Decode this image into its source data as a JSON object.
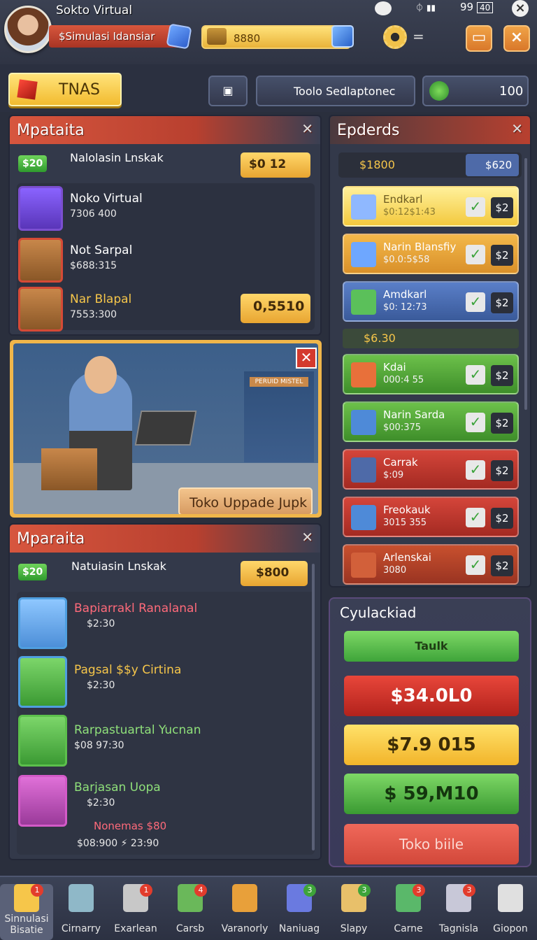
{
  "status": {
    "signal": "99",
    "battery_label": "40"
  },
  "header": {
    "game_title": "Sokto Virtual",
    "player_name": "$Simulasi Idansiar",
    "gold": "8880",
    "top_eq": "="
  },
  "toolbar": {
    "tnas_label": "TNAS",
    "center_label": "Toolo Sedlaptonec",
    "currency": "100"
  },
  "left_panel": {
    "title": "Mpataita",
    "badge": "$20",
    "subtitle": "Nalolasin Lnskak",
    "price": "$0 12",
    "items": [
      {
        "title": "Noko Virtual",
        "sub": "7306 400"
      },
      {
        "title": "Not Sarpal",
        "sub": "$688:315"
      },
      {
        "title": "Nar Blapal",
        "sub": "7553:300",
        "price": "0,5510"
      }
    ]
  },
  "promo": {
    "store_sign": "PERUID MISTEL",
    "button": "Toko Uppade Jupk"
  },
  "lower_panel": {
    "title": "Mparaita",
    "badge": "$20",
    "subtitle": "Natuiasin Lnskak",
    "price": "$800",
    "items": [
      {
        "title": "Bapiarrakl Ranalanal",
        "sub": "$2:30"
      },
      {
        "title": "Pagsal $$y Cirtina",
        "sub": "$2:30"
      },
      {
        "title": "Rarpastuartal Yucnan",
        "sub": "$08 97:30"
      },
      {
        "title": "Barjasan Uopa",
        "sub": "$2:30",
        "extra": "Nonemas $80",
        "extra2": "$08:900 ⚡ 23:90"
      }
    ]
  },
  "right_panel": {
    "title": "Epderds",
    "top_left": "$1800",
    "top_right": "$620",
    "section": "$6.30",
    "items": [
      {
        "title": "Endkarl",
        "sub": "$0:12$1:43",
        "num": "$2"
      },
      {
        "title": "Narin Blansfiy",
        "sub": "$0.0:5$58",
        "num": "$2"
      },
      {
        "title": "Amdkarl",
        "sub": "$0: 12:73",
        "num": "$2"
      },
      {
        "title": "Kdai",
        "sub": "000:4 55",
        "num": "$2"
      },
      {
        "title": "Narin Sarda",
        "sub": "$00:375",
        "num": "$2"
      },
      {
        "title": "Carrak",
        "sub": "$:09",
        "num": "$2"
      },
      {
        "title": "Freokauk",
        "sub": "3015 355",
        "num": "$2"
      },
      {
        "title": "Arlenskai",
        "sub": "3080",
        "num": "$2"
      }
    ]
  },
  "calc": {
    "title": "Cyulackiad",
    "tab": "Taulk",
    "b1": "$34.0L0",
    "b2": "$7.9 015",
    "b3": "$ 59,M10",
    "b4": "Toko biile"
  },
  "nav": [
    {
      "label": "Sinnulasi Bisatie",
      "badge": "1"
    },
    {
      "label": "Cirnarry",
      "badge": ""
    },
    {
      "label": "Exarlean",
      "badge": "1"
    },
    {
      "label": "Carsb",
      "badge": "4"
    },
    {
      "label": "Varanorly",
      "badge": ""
    },
    {
      "label": "Naniuag",
      "badge": "3"
    },
    {
      "label": "Slapy",
      "badge": "3"
    },
    {
      "label": "Carne",
      "badge": "3"
    },
    {
      "label": "Tagnisla",
      "badge": "3"
    },
    {
      "label": "Giopon",
      "badge": ""
    }
  ]
}
